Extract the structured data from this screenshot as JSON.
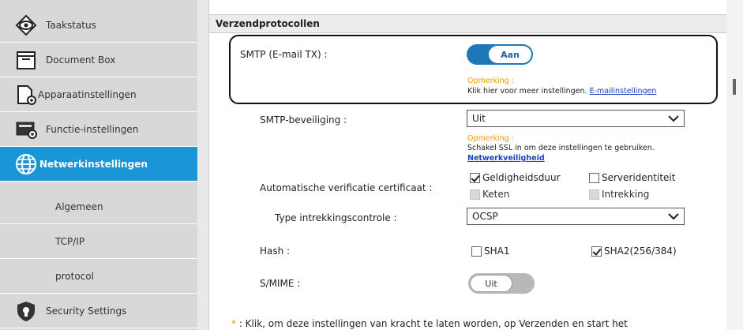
{
  "sidebar": {
    "items": [
      {
        "label": "Taakstatus",
        "icon": "eye-icon"
      },
      {
        "label": "Document Box",
        "icon": "folder-icon"
      },
      {
        "label": "Apparaatinstellingen",
        "icon": "device-settings-icon"
      },
      {
        "label": "Functie-instellingen",
        "icon": "function-settings-icon"
      },
      {
        "label": "Netwerkinstellingen",
        "icon": "globe-icon"
      },
      {
        "label": "Security Settings",
        "icon": "shield-icon"
      }
    ],
    "subitems": [
      {
        "label": "Algemeen"
      },
      {
        "label": "TCP/IP"
      },
      {
        "label": "protocol"
      }
    ]
  },
  "section": {
    "title": "Verzendprotocollen"
  },
  "smtp": {
    "label": "SMTP (E-mail TX) :",
    "toggle": "Aan",
    "note_title": "Opmerking :",
    "note_text": "Klik hier voor meer instellingen.",
    "note_link": "E-mailinstellingen"
  },
  "smtp_security": {
    "label": "SMTP-beveiliging :",
    "value": "Uit",
    "note_title": "Opmerking :",
    "note_text": "Schakel SSL in om deze instellingen te gebruiken.",
    "note_link": "Netwerkveiligheid"
  },
  "cert_verify": {
    "label": "Automatische verificatie certificaat :",
    "options": [
      {
        "label": "Geldigheidsduur",
        "checked": true,
        "disabled": false
      },
      {
        "label": "Serveridentiteit",
        "checked": false,
        "disabled": false
      },
      {
        "label": "Keten",
        "checked": false,
        "disabled": true
      },
      {
        "label": "Intrekking",
        "checked": false,
        "disabled": true
      }
    ]
  },
  "revocation": {
    "label": "Type intrekkingscontrole :",
    "value": "OCSP"
  },
  "hash": {
    "label": "Hash :",
    "options": [
      {
        "label": "SHA1",
        "checked": false
      },
      {
        "label": "SHA2(256/384)",
        "checked": true
      }
    ]
  },
  "smime": {
    "label": "S/MIME :",
    "toggle": "Uit"
  },
  "footer": {
    "star": "*",
    "text": ": Klik, om deze instellingen van kracht te laten worden, op Verzenden en start het"
  },
  "colors": {
    "accent": "#1a96d6",
    "note": "#f29a00",
    "toggle_on": "#1c78b8"
  }
}
